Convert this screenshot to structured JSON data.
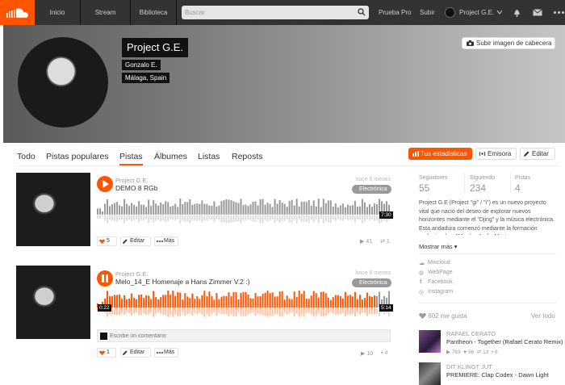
{
  "nav": {
    "home": "Inicio",
    "stream": "Stream",
    "library": "Biblioteca",
    "search_placeholder": "Buscar",
    "pro": "Prueba Pro",
    "upload": "Subir",
    "user": "Project G.E."
  },
  "profile": {
    "name": "Project G.E.",
    "realname": "Gonzalo E.",
    "location": "Málaga, Spain",
    "upload_header": "Subir imagen de cabecera"
  },
  "tabs": [
    "Todo",
    "Pistas populares",
    "Pistas",
    "Álbumes",
    "Listas",
    "Reposts"
  ],
  "actions": {
    "stats": "Tus estadísticas",
    "station": "Emisora",
    "edit": "Editar"
  },
  "tracks": [
    {
      "user": "Project G.E.",
      "title": "DEMO 8 RGb",
      "ago": "hace 6 meses",
      "genre": "Electrónica",
      "duration": "7:30",
      "progress": 0,
      "likes": "5",
      "edit": "Editar",
      "more": "Más",
      "plays": "41",
      "reposts": "1",
      "comments": ""
    },
    {
      "user": "Project G.E.",
      "title": "Melo_14_E Homenaje a Hans Zimmer V.2 :)",
      "ago": "hace 6 meses",
      "genre": "Electrónica",
      "elapsed": "0:22",
      "duration": "5:14",
      "progress": 0.95,
      "likes": "1",
      "edit": "Editar",
      "more": "Más",
      "plays": "10",
      "reposts": "",
      "comments": "4"
    }
  ],
  "comment_placeholder": "Escribe un comentario",
  "sidebar": {
    "followers_label": "Seguidores",
    "followers": "55",
    "following_label": "Siguiendo",
    "following": "234",
    "tracks_label": "Pistas",
    "tracks": "4",
    "bio": "Project G.E (Project \"gi\" / \"i\") es un nuevo proyecto vital que nació del deseo de explorar nuevos horizontes mediante el \"Djing\" y la música electrónica. Esta andadura comenzó mediante la formación profesional en \"Mixpluz Audio Master",
    "show_more": "Mostrar más",
    "links": [
      "Mixcloud",
      "WebPage",
      "Facebook",
      "Instagram"
    ],
    "likes_label": "602 me gusta",
    "view_all": "Ver todo",
    "liked": [
      {
        "artist": "RAFAEL CERATO",
        "track": "Pantheon - Together (Rafael Cerato Remix)",
        "plays": "783",
        "likes": "96",
        "reposts": "13",
        "comments": "6"
      },
      {
        "artist": "DIT KLINGT JUT",
        "track": "PREMIERE: Clap Codex - Dawn Light"
      }
    ]
  },
  "colors": {
    "accent": "#ff5500",
    "topbar": "#333333"
  }
}
